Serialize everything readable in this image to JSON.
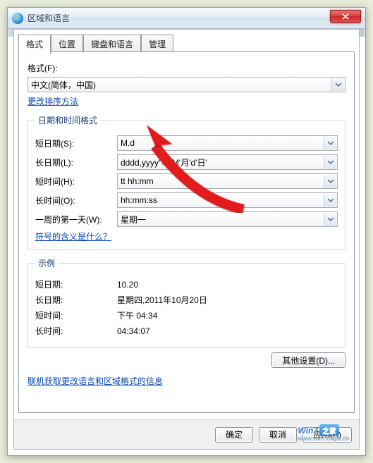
{
  "window": {
    "title": "区域和语言"
  },
  "tabs": [
    "格式",
    "位置",
    "键盘和语言",
    "管理"
  ],
  "format": {
    "label": "格式(F):",
    "value": "中文(简体，中国)",
    "sort_link": "更改排序方法"
  },
  "datetime_group": {
    "legend": "日期和时间格式",
    "rows": {
      "short_date": {
        "label": "短日期(S):",
        "value": "M.d"
      },
      "long_date": {
        "label": "长日期(L):",
        "value": "dddd,yyyy''年'M'月'd'日'"
      },
      "short_time": {
        "label": "短时间(H):",
        "value": "tt hh:mm"
      },
      "long_time": {
        "label": "长时间(O):",
        "value": "hh:mm:ss"
      },
      "first_day": {
        "label": "一周的第一天(W):",
        "value": "星期一"
      }
    },
    "meaning_link": "符号的含义是什么？"
  },
  "example_group": {
    "legend": "示例",
    "rows": {
      "short_date": {
        "label": "短日期:",
        "value": "10.20"
      },
      "long_date": {
        "label": "长日期:",
        "value": "星期四,2011年10月20日"
      },
      "short_time": {
        "label": "短时间:",
        "value": "下午 04:34"
      },
      "long_time": {
        "label": "长时间:",
        "value": "04:34:07"
      }
    }
  },
  "buttons": {
    "other": "其他设置(D)...",
    "online_link": "联机获取更改语言和区域格式的信息",
    "ok": "确定",
    "cancel": "取消",
    "apply": "应用(A)"
  },
  "watermark": {
    "brand": "Win7",
    "badge": "之家",
    "url": "www.win7zhijia.cn"
  }
}
